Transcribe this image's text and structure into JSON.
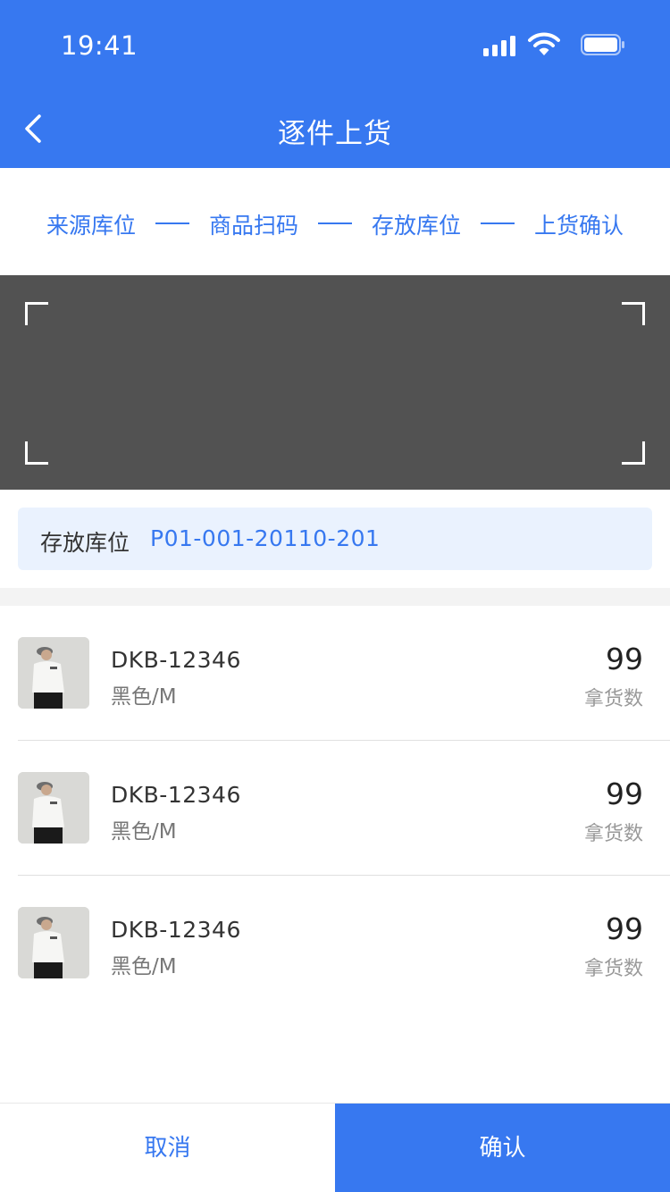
{
  "status_bar": {
    "time": "19:41"
  },
  "nav": {
    "title": "逐件上货",
    "back_icon": "chevron-left-icon"
  },
  "steps": [
    "来源库位",
    "商品扫码",
    "存放库位",
    "上货确认"
  ],
  "location": {
    "label": "存放库位",
    "value": "P01-001-20110-201"
  },
  "products": [
    {
      "sku": "DKB-12346",
      "variant": "黑色/M",
      "qty": "99",
      "qty_label": "拿货数"
    },
    {
      "sku": "DKB-12346",
      "variant": "黑色/M",
      "qty": "99",
      "qty_label": "拿货数"
    },
    {
      "sku": "DKB-12346",
      "variant": "黑色/M",
      "qty": "99",
      "qty_label": "拿货数"
    }
  ],
  "actions": {
    "cancel": "取消",
    "confirm": "确认"
  },
  "colors": {
    "primary": "#3778f0",
    "scanner_bg": "#525252",
    "location_bg": "#eaf2fe"
  }
}
